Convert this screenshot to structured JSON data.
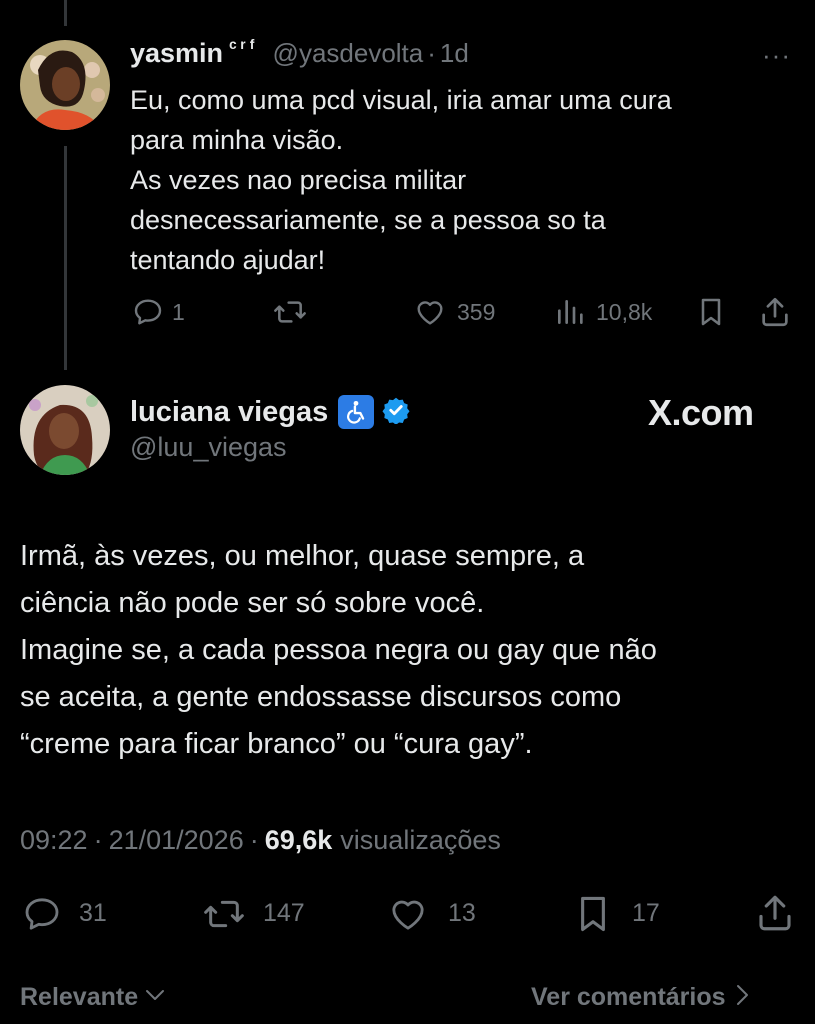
{
  "reply": {
    "name": "yasmin",
    "name_suffix": "ᶜʳᶠ",
    "handle": "@yasdevolta",
    "separator": "·",
    "time": "1d",
    "more": "···",
    "lines": [
      "Eu, como uma pcd visual, iria amar uma cura",
      "para minha visão.",
      "As vezes nao precisa militar",
      "desnecessariamente, se a pessoa so ta",
      "tentando ajudar!"
    ],
    "actions": {
      "replies": "1",
      "reposts": "",
      "likes": "359",
      "views": "10,8k"
    }
  },
  "main": {
    "name": "luciana viegas",
    "emoji": "♿",
    "handle": "@luu_viegas",
    "watermark": "X.com",
    "lines": [
      "Irmã, às vezes, ou melhor, quase sempre, a",
      "ciência não pode ser só sobre você.",
      "Imagine se, a cada pessoa negra ou gay que não",
      "se aceita, a gente endossasse discursos como",
      "“creme para ficar branco” ou “cura gay”."
    ],
    "meta": {
      "time": "09:22",
      "sep1": "·",
      "date": "21/01/2026",
      "sep2": "·",
      "views_count": "69,6k",
      "views_label": "visualizações"
    },
    "actions": {
      "replies": "31",
      "reposts": "147",
      "likes": "13",
      "bookmarks": "17"
    }
  },
  "footer": {
    "sort_label": "Relevante",
    "comments_label": "Ver comentários"
  },
  "colors": {
    "background": "#000000",
    "text": "#e7e9ea",
    "muted": "#71767b",
    "verified": "#1d9bf0"
  }
}
